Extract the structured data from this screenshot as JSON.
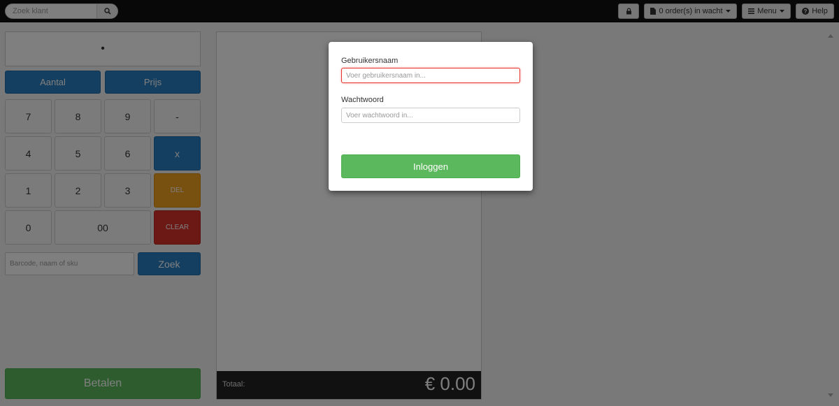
{
  "topbar": {
    "search_placeholder": "Zoek klant",
    "search_icon": "search-icon",
    "lock_icon": "lock-icon",
    "orders_label": "0 order(s) in wacht",
    "menu_label": "Menu",
    "help_label": "Help"
  },
  "keypad": {
    "display_value": "•",
    "aantal_label": "Aantal",
    "prijs_label": "Prijs",
    "keys": {
      "k7": "7",
      "k8": "8",
      "k9": "9",
      "minus": "-",
      "k4": "4",
      "k5": "5",
      "k6": "6",
      "times": "x",
      "k1": "1",
      "k2": "2",
      "k3": "3",
      "del": "DEL",
      "k0": "0",
      "k00": "00",
      "clear": "CLEAR"
    },
    "barcode_placeholder": "Barcode, naam of sku",
    "zoek_label": "Zoek",
    "pay_label": "Betalen"
  },
  "order": {
    "total_label": "Totaal:",
    "total_value": "€ 0.00"
  },
  "login": {
    "username_label": "Gebruikersnaam",
    "username_placeholder": "Voer gebruikersnaam in...",
    "password_label": "Wachtwoord",
    "password_placeholder": "Voer wachtwoord in...",
    "login_label": "Inloggen"
  },
  "colors": {
    "primary": "#2a7ec0",
    "success": "#5cb85c",
    "warning": "#f0a020",
    "danger": "#d9312b",
    "topbar": "#111111"
  }
}
